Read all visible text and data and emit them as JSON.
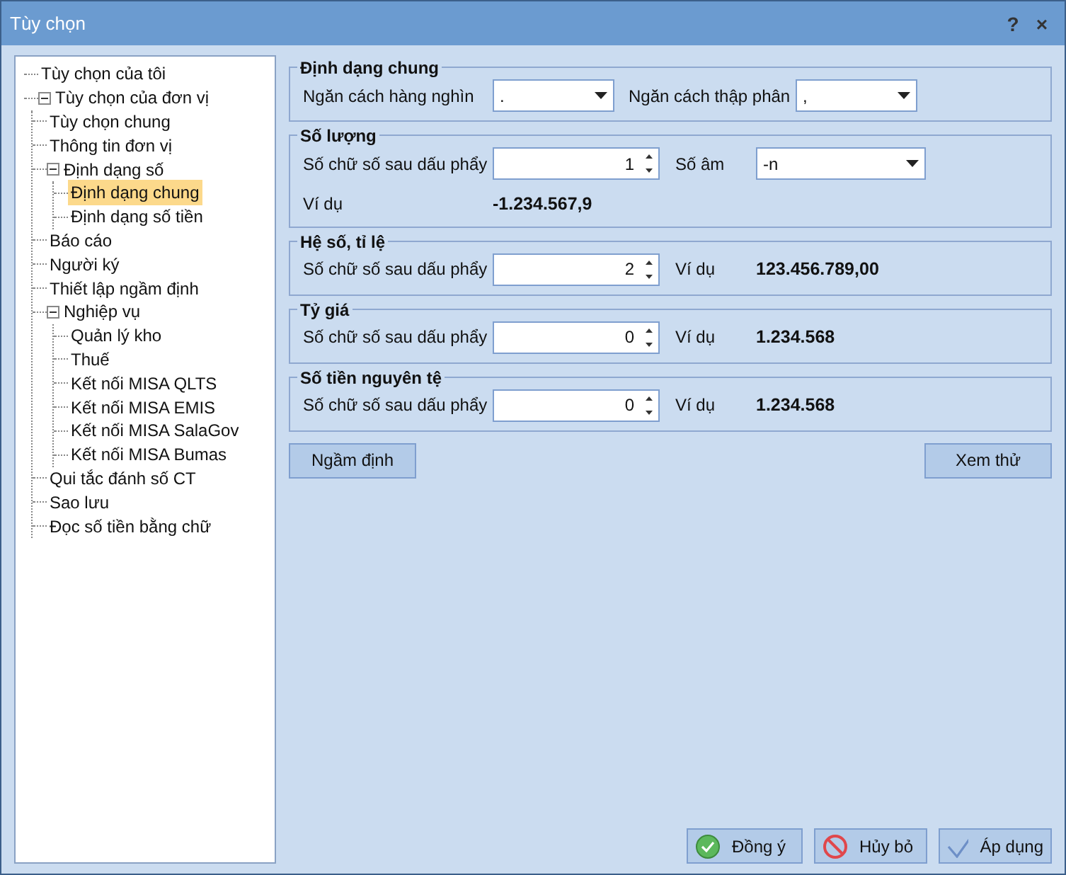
{
  "window": {
    "title": "Tùy chọn",
    "help": "?",
    "close": "×"
  },
  "tree": [
    {
      "label": "Tùy chọn của tôi",
      "selected": false
    },
    {
      "label": "Tùy chọn của đơn vị",
      "selected": false,
      "expanded": true,
      "children": [
        {
          "label": "Tùy chọn chung",
          "selected": false
        },
        {
          "label": "Thông tin đơn vị",
          "selected": false
        },
        {
          "label": "Định dạng số",
          "selected": false,
          "expanded": true,
          "children": [
            {
              "label": "Định dạng chung",
              "selected": true
            },
            {
              "label": "Định dạng số tiền",
              "selected": false
            }
          ]
        },
        {
          "label": "Báo cáo",
          "selected": false
        },
        {
          "label": "Người ký",
          "selected": false
        },
        {
          "label": "Thiết lập ngầm định",
          "selected": false
        },
        {
          "label": "Nghiệp vụ",
          "selected": false,
          "expanded": true,
          "children": [
            {
              "label": "Quản lý kho",
              "selected": false
            },
            {
              "label": "Thuế",
              "selected": false
            },
            {
              "label": "Kết nối MISA QLTS",
              "selected": false
            },
            {
              "label": "Kết nối MISA EMIS",
              "selected": false
            },
            {
              "label": "Kết nối MISA SalaGov",
              "selected": false
            },
            {
              "label": "Kết nối MISA Bumas",
              "selected": false
            }
          ]
        },
        {
          "label": "Qui tắc đánh số CT",
          "selected": false
        },
        {
          "label": "Sao lưu",
          "selected": false
        },
        {
          "label": "Đọc số tiền bằng chữ",
          "selected": false
        }
      ]
    }
  ],
  "groups": [
    {
      "title": "Định dạng chung",
      "kind": "separators",
      "items": [
        {
          "kind": "dropdown",
          "label": "Ngăn cách hàng nghìn",
          "value": "."
        },
        {
          "kind": "dropdown",
          "label": "Ngăn cách thập phân",
          "value": ","
        }
      ]
    },
    {
      "title": "Số lượng",
      "kind": "digits",
      "items": [
        {
          "kind": "spin",
          "label": "Số chữ số sau dấu phẩy",
          "value": "1"
        },
        {
          "kind": "dropdown",
          "label": "Số âm",
          "value": "-n"
        },
        {
          "kind": "example",
          "label": "Ví dụ",
          "value": "-1.234.567,9"
        }
      ]
    },
    {
      "title": "Hệ số, tỉ lệ",
      "kind": "digits",
      "items": [
        {
          "kind": "spin",
          "label": "Số chữ số sau dấu phẩy",
          "value": "2"
        },
        {
          "kind": "example",
          "label": "Ví dụ",
          "value": "123.456.789,00"
        }
      ]
    },
    {
      "title": "Tỷ giá",
      "kind": "digits",
      "items": [
        {
          "kind": "spin",
          "label": "Số chữ số sau dấu phẩy",
          "value": "0"
        },
        {
          "kind": "example",
          "label": "Ví dụ",
          "value": "1.234.568"
        }
      ]
    },
    {
      "title": "Số tiền nguyên tệ",
      "kind": "digits",
      "items": [
        {
          "kind": "spin",
          "label": "Số chữ số sau dấu phẩy",
          "value": "0"
        },
        {
          "kind": "example",
          "label": "Ví dụ",
          "value": "1.234.568"
        }
      ]
    }
  ],
  "panel_buttons": [
    "Ngầm định",
    "Xem thử"
  ],
  "footer_buttons": [
    {
      "kind": "ok",
      "label": "Đồng ý"
    },
    {
      "kind": "cancel",
      "label": "Hủy bỏ"
    },
    {
      "kind": "apply",
      "label": "Áp dụng"
    }
  ]
}
